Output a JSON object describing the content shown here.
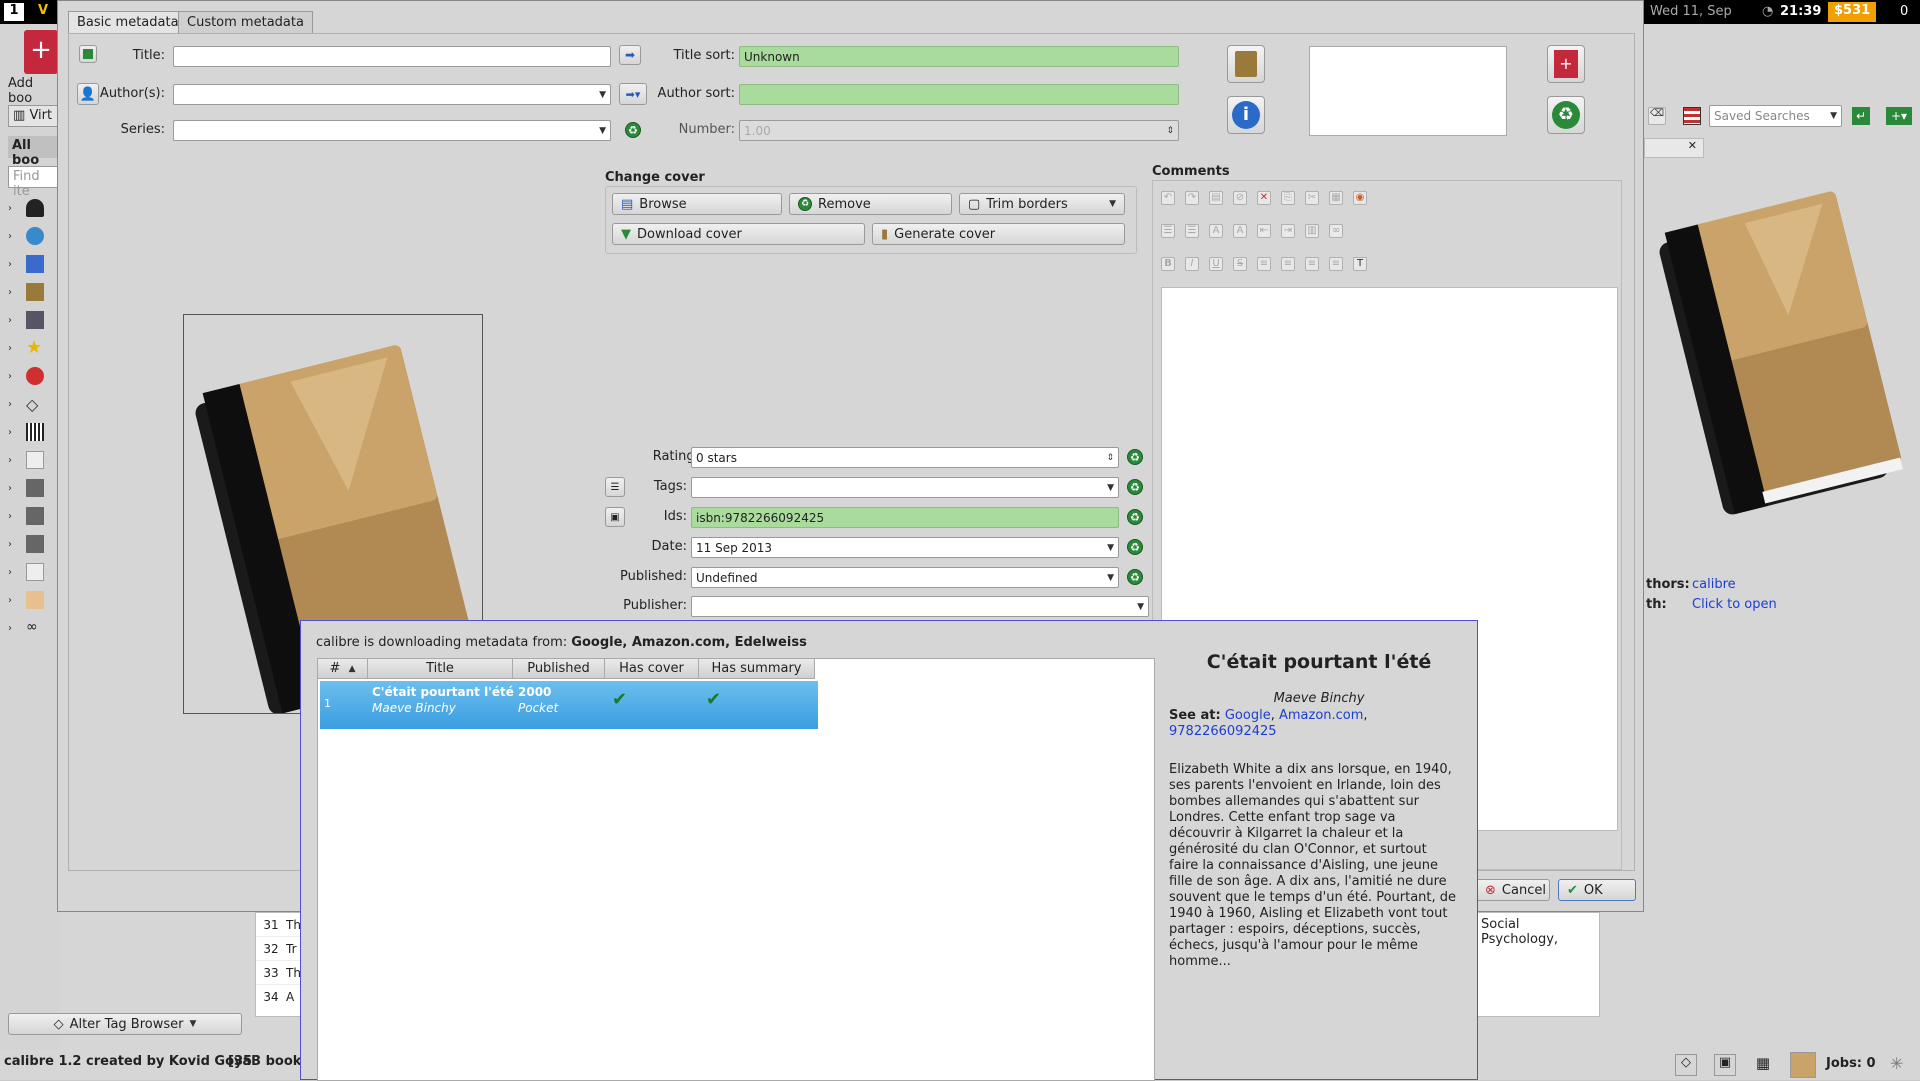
{
  "topbar": {
    "workspace": "1",
    "app_letter": "V",
    "datetime": "Wed 11, Sep",
    "clock": "21:39",
    "money": "$531",
    "counter": "0"
  },
  "library": {
    "add_books_label": "Add boo",
    "virtual_label": "Virt",
    "all_books_label": "All boo",
    "find_placeholder": "Find ite",
    "saved_searches": "Saved Searches",
    "alter_tag_browser": "Alter Tag Browser",
    "status": "calibre 1.2 created by Kovid Goyal",
    "book_count": "[353 books",
    "jobs": "Jobs: 0",
    "rows": [
      {
        "num": "31",
        "text": "Th"
      },
      {
        "num": "32",
        "text": "Tr"
      },
      {
        "num": "33",
        "text": "Th"
      },
      {
        "num": "34",
        "text": "A"
      }
    ],
    "right_row_text": "Social Psychology,",
    "details_authors_label": "thors:",
    "details_authors_value": "calibre",
    "details_path_label": "th:",
    "details_path_value": "Click to open"
  },
  "meta_dialog": {
    "tabs": [
      "Basic metadata",
      "Custom metadata"
    ],
    "title_label": "Title:",
    "title_value": "",
    "title_sort_label": "Title sort:",
    "title_sort_value": "Unknown",
    "authors_label": "Author(s):",
    "authors_value": "",
    "author_sort_label": "Author sort:",
    "author_sort_value": "",
    "series_label": "Series:",
    "series_value": "",
    "number_label": "Number:",
    "number_value": "1.00",
    "change_cover_label": "Change cover",
    "browse_label": "Browse",
    "remove_label": "Remove",
    "trim_label": "Trim borders",
    "download_cover_label": "Download cover",
    "generate_cover_label": "Generate cover",
    "comments_label": "Comments",
    "rating_label": "Rating:",
    "rating_value": "0 stars",
    "tags_label": "Tags:",
    "tags_value": "",
    "ids_label": "Ids:",
    "ids_value": "isbn:9782266092425",
    "date_label": "Date:",
    "date_value": "11 Sep 2013",
    "published_label": "Published:",
    "published_value": "Undefined",
    "publisher_label": "Publisher:",
    "publisher_value": "",
    "cancel_label": "Cancel",
    "ok_label": "OK"
  },
  "download_dialog": {
    "status_prefix": "calibre is downloading metadata from: ",
    "sources": "Google, Amazon.com, Edelweiss",
    "columns": [
      "#",
      "Title",
      "Published",
      "Has cover",
      "Has summary"
    ],
    "result": {
      "num": "1",
      "title": "C'était pourtant l'été",
      "author": "Maeve Binchy",
      "year": "2000",
      "format": "Pocket"
    },
    "detail": {
      "title": "C'était pourtant l'été",
      "author": "Maeve Binchy",
      "see_at_label": "See at:",
      "link1": "Google",
      "link2": "Amazon.com",
      "link3": "9782266092425",
      "summary": "Elizabeth White a dix ans lorsque, en 1940, ses parents l'envoient en Irlande, loin des bombes allemandes qui s'abattent sur Londres. Cette enfant trop sage va découvrir à Kilgarret la chaleur et la générosité du clan O'Connor, et surtout faire la connaissance d'Aisling, une jeune fille de son âge. A dix ans, l'amitié ne dure souvent que le temps d'un été. Pourtant, de 1940 à 1960, Aisling et Elizabeth vont tout partager : espoirs, déceptions, succès, échecs, jusqu'à l'amour pour le même homme..."
    }
  },
  "colors": {
    "green_field": "#a9db9d",
    "selection": "#3a9de0",
    "link": "#1c3ed0",
    "topbar": "#000000",
    "money_bg": "#f0a000"
  }
}
